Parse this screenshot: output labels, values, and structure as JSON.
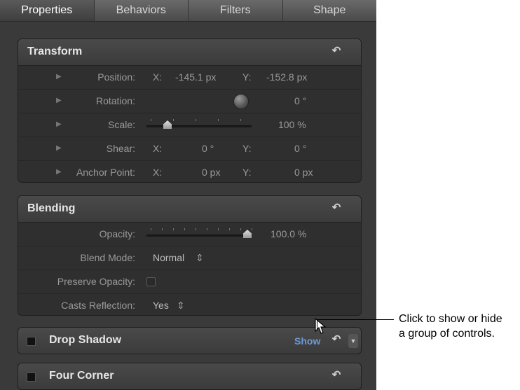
{
  "tabs": [
    "Properties",
    "Behaviors",
    "Filters",
    "Shape"
  ],
  "transform": {
    "title": "Transform",
    "rows": [
      {
        "label": "Position:",
        "x_label": "X:",
        "x_value": "-145.1 px",
        "y_label": "Y:",
        "y_value": "-152.8 px"
      },
      {
        "label": "Rotation:",
        "value": "0 °"
      },
      {
        "label": "Scale:",
        "value": "100 %",
        "slider_level": 0.2
      },
      {
        "label": "Shear:",
        "x_label": "X:",
        "x_value": "0 °",
        "y_label": "Y:",
        "y_value": "0 °"
      },
      {
        "label": "Anchor Point:",
        "x_label": "X:",
        "x_value": "0 px",
        "y_label": "Y:",
        "y_value": "0 px"
      }
    ]
  },
  "blending": {
    "title": "Blending",
    "opacity_label": "Opacity:",
    "opacity_value": "100.0 %",
    "opacity_level": 1.0,
    "blend_mode_label": "Blend Mode:",
    "blend_mode_value": "Normal",
    "preserve_opacity_label": "Preserve Opacity:",
    "casts_reflection_label": "Casts Reflection:",
    "casts_reflection_value": "Yes"
  },
  "drop_shadow": {
    "title": "Drop Shadow",
    "show_label": "Show"
  },
  "four_corner": {
    "title": "Four Corner"
  },
  "callout": {
    "line1": "Click to show or hide",
    "line2": "a group of controls."
  },
  "icons": {
    "reset": "reset-arrow-icon",
    "disclosure": "disclosure-triangle-icon",
    "stepper": "up-down-stepper-icon"
  }
}
